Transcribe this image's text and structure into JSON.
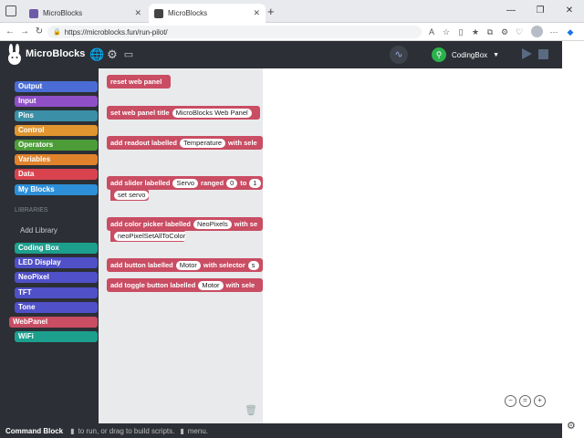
{
  "browser": {
    "tabs": [
      {
        "title": "MicroBlocks",
        "active": false
      },
      {
        "title": "MicroBlocks",
        "active": true
      }
    ],
    "url": "https://microblocks.fun/run-pilot/",
    "window_controls": [
      "—",
      "❐",
      "✕"
    ]
  },
  "app": {
    "name": "MicroBlocks",
    "board": "CodingBox"
  },
  "palette": {
    "categories": [
      {
        "label": "Output",
        "color": "#4a6cd4"
      },
      {
        "label": "Input",
        "color": "#8f4fc7"
      },
      {
        "label": "Pins",
        "color": "#3b8fa6"
      },
      {
        "label": "Control",
        "color": "#e09530"
      },
      {
        "label": "Operators",
        "color": "#4c9c38"
      },
      {
        "label": "Variables",
        "color": "#e0832c"
      },
      {
        "label": "Data",
        "color": "#d9434e"
      },
      {
        "label": "My Blocks",
        "color": "#2d8fd8"
      }
    ],
    "libraries_title": "LIBRARIES",
    "add_library": "Add Library",
    "libraries": [
      {
        "label": "Coding Box",
        "color": "#1d9f8e"
      },
      {
        "label": "LED Display",
        "color": "#5050c8"
      },
      {
        "label": "NeoPixel",
        "color": "#5050c8"
      },
      {
        "label": "TFT",
        "color": "#5050c8"
      },
      {
        "label": "Tone",
        "color": "#5050c8"
      },
      {
        "label": "WebPanel",
        "color": "#c94d63"
      },
      {
        "label": "WiFi",
        "color": "#1d9f8e"
      }
    ]
  },
  "blocks": {
    "reset": {
      "text": "reset web panel"
    },
    "title": {
      "text": "set web panel title",
      "arg": "MicroBlocks Web Panel"
    },
    "readout": {
      "text": "add readout labelled",
      "arg": "Temperature",
      "tail": "with sele"
    },
    "slider": {
      "text": "add slider labelled",
      "arg": "Servo",
      "mid": "ranged",
      "arg2": "0",
      "to": "to",
      "arg3": "1",
      "sub": "set servo"
    },
    "color": {
      "text": "add color picker labelled",
      "arg": "NeoPixels",
      "tail": "with se",
      "sub": "neoPixelSetAllToColor"
    },
    "button": {
      "text": "add button labelled",
      "arg": "Motor",
      "tail": "with selector",
      "arg2": "s"
    },
    "toggle": {
      "text": "add toggle button labelled",
      "arg": "Motor",
      "tail": "with sele"
    }
  },
  "statusbar": {
    "title": "Command Block",
    "hint": "to run, or drag to build scripts.",
    "menu": "menu."
  }
}
